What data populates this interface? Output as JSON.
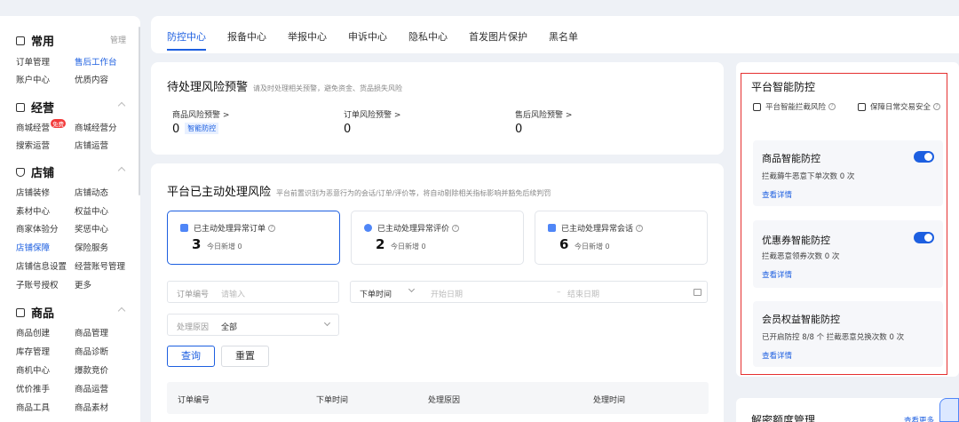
{
  "sidebar": {
    "sections": [
      {
        "title": "常用",
        "right": "管理",
        "items": [
          [
            "订单管理",
            "售后工作台"
          ],
          [
            "账户中心",
            "优质内容"
          ]
        ]
      },
      {
        "title": "经营",
        "items": [
          [
            "商城经营",
            "商城经营分"
          ],
          [
            "搜索运营",
            "店铺运营"
          ]
        ],
        "badge": "免费"
      },
      {
        "title": "店铺",
        "items": [
          [
            "店铺装修",
            "店铺动态"
          ],
          [
            "素材中心",
            "权益中心"
          ],
          [
            "商家体验分",
            "奖惩中心"
          ],
          [
            "店铺保障",
            "保险服务"
          ],
          [
            "店铺信息设置",
            "经营账号管理"
          ],
          [
            "子账号授权",
            "更多"
          ]
        ]
      },
      {
        "title": "商品",
        "items": [
          [
            "商品创建",
            "商品管理"
          ],
          [
            "库存管理",
            "商品诊断"
          ],
          [
            "商机中心",
            "爆款竞价"
          ],
          [
            "优价推手",
            "商品运营"
          ],
          [
            "商品工具",
            "商品素材"
          ]
        ]
      }
    ]
  },
  "tabs": [
    "防控中心",
    "报备中心",
    "举报中心",
    "申诉中心",
    "隐私中心",
    "首发图片保护",
    "黑名单"
  ],
  "risk_warning": {
    "title": "待处理风险预警",
    "subtitle": "请及时处理相关预警，避免资金、货品损失风险",
    "stats": [
      {
        "label": "商品风险预警 >",
        "value": "0",
        "tag": "智能防控"
      },
      {
        "label": "订单风险预警 >",
        "value": "0"
      },
      {
        "label": "售后风险预警 >",
        "value": "0"
      }
    ]
  },
  "processed": {
    "title": "平台已主动处理风险",
    "subtitle": "平台前置识别为恶意行为的会话/订单/评价等，将自动剔除相关指标影响并豁免后续判罚",
    "cards": [
      {
        "label": "已主动处理异常订单",
        "value": "3",
        "today": "今日新增 0"
      },
      {
        "label": "已主动处理异常评价",
        "value": "2",
        "today": "今日新增 0"
      },
      {
        "label": "已主动处理异常会话",
        "value": "6",
        "today": "今日新增 0"
      }
    ],
    "filters": {
      "order_no_label": "订单编号",
      "order_no_placeholder": "请输入",
      "time_label": "下单时间",
      "start_placeholder": "开始日期",
      "end_placeholder": "结束日期",
      "reason_label": "处理原因",
      "reason_value": "全部"
    },
    "query_button": "查询",
    "reset_button": "重置",
    "columns": [
      "订单编号",
      "下单时间",
      "处理原因",
      "处理时间"
    ]
  },
  "smart_defense": {
    "title": "平台智能防控",
    "badges": [
      "平台智能拦截风险",
      "保障日常交易安全"
    ],
    "cards": [
      {
        "title": "商品智能防控",
        "desc": "拦截薅牛恶意下单次数 0 次",
        "link": "查看详情",
        "enabled": true
      },
      {
        "title": "优惠券智能防控",
        "desc": "拦截恶意领券次数 0 次",
        "link": "查看详情",
        "enabled": true
      },
      {
        "title": "会员权益智能防控",
        "desc": "已开启防控 8/8 个  拦截恶意兑换次数 0 次",
        "link": "查看详情"
      }
    ]
  },
  "next_panel_title": "解密额度管理",
  "next_panel_link": "查看更多",
  "colors": {
    "accent": "#1d5fe0",
    "highlight_border": "#e53030",
    "badge_red": "#f23b3b"
  }
}
